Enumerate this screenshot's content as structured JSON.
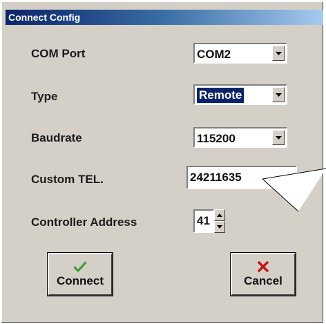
{
  "window": {
    "title": "Connect Config"
  },
  "fields": {
    "com_port": {
      "label": "COM Port",
      "value": "COM2"
    },
    "type": {
      "label": "Type",
      "value": "Remote"
    },
    "baudrate": {
      "label": "Baudrate",
      "value": "115200"
    },
    "custom_tel": {
      "label": "Custom TEL.",
      "value": "24211635"
    },
    "controller_address": {
      "label": "Controller Address",
      "value": "41"
    }
  },
  "buttons": {
    "connect": {
      "label": "Connect",
      "icon": "checkmark-icon",
      "color": "#2e9a2e"
    },
    "cancel": {
      "label": "Cancel",
      "icon": "x-icon",
      "color": "#c01818"
    }
  },
  "colors": {
    "dialog_bg": "#d4d0c8",
    "titlebar_start": "#0a246a",
    "titlebar_end": "#a6caf0",
    "selection": "#0a246a"
  }
}
